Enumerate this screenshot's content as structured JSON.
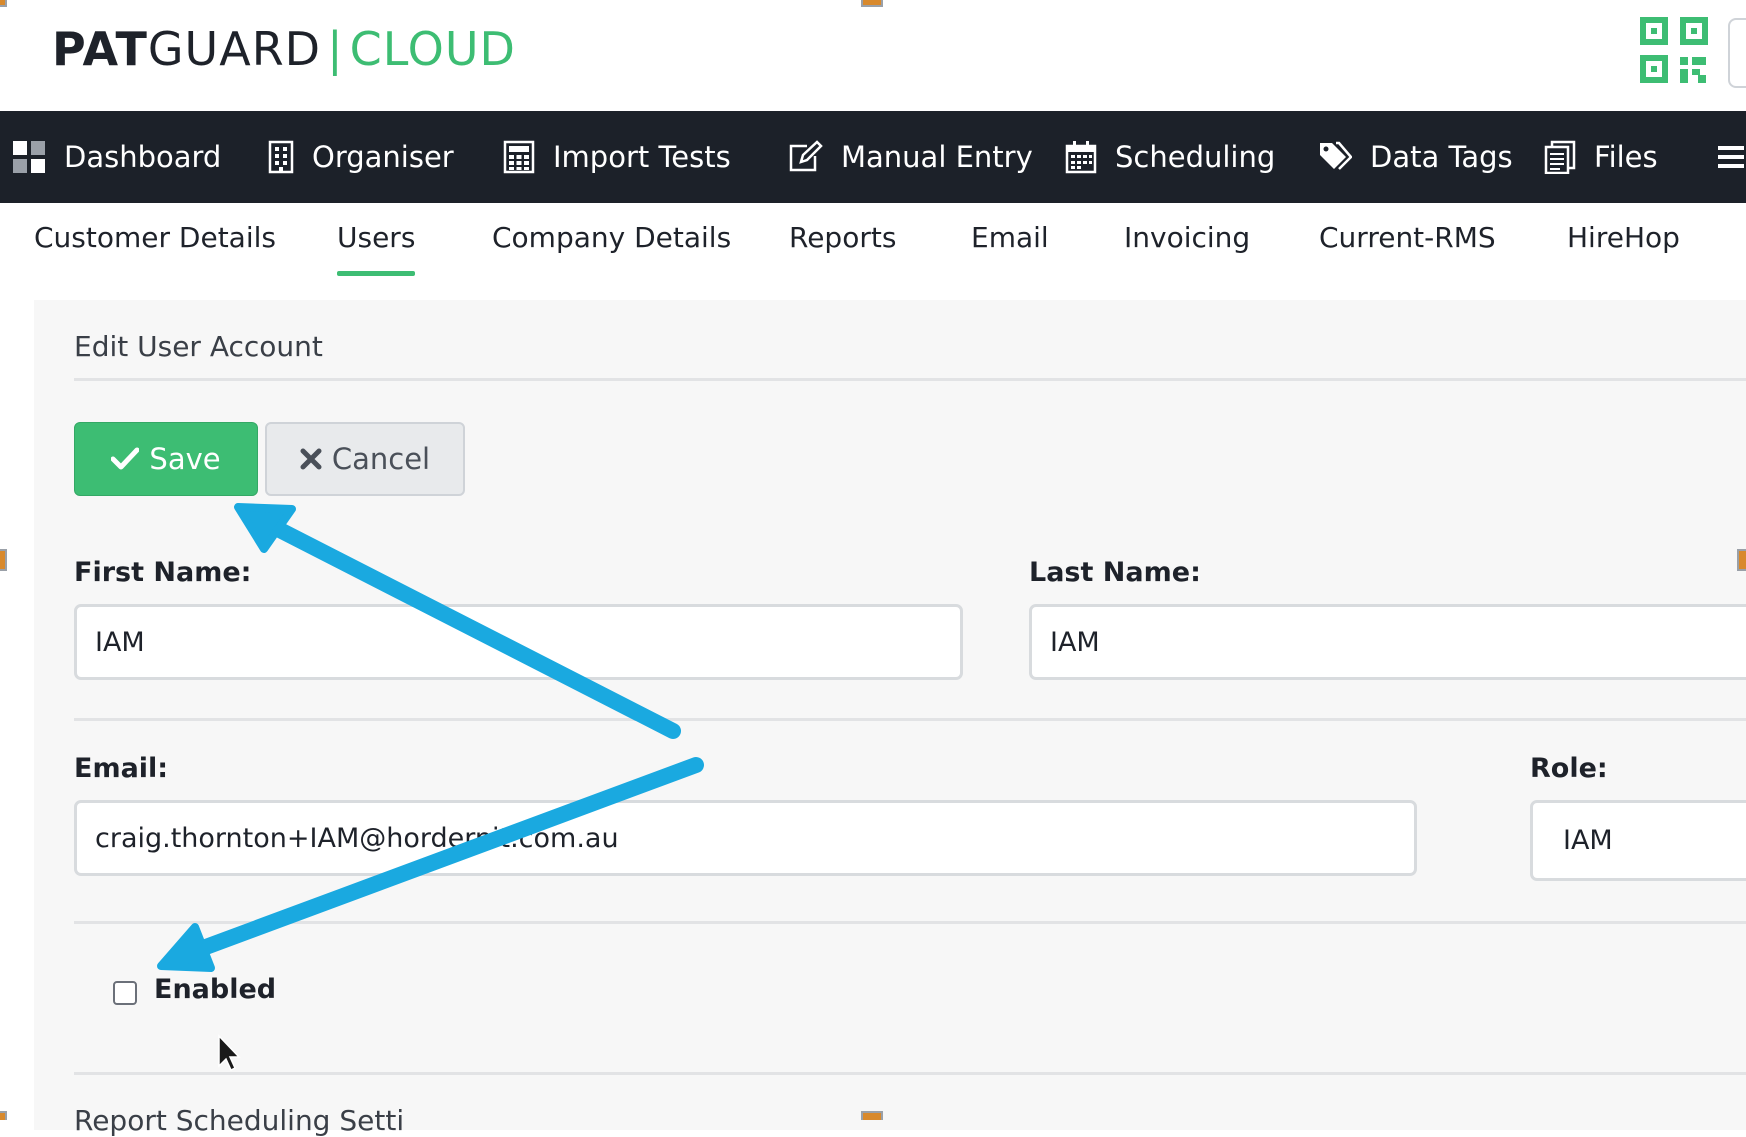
{
  "brand": {
    "part1": "PAT",
    "part2": "GUARD",
    "separator": "|",
    "part3": "CLOUD"
  },
  "nav": {
    "items": [
      {
        "label": "Dashboard",
        "icon": "dashboard-icon"
      },
      {
        "label": "Organiser",
        "icon": "building-icon"
      },
      {
        "label": "Import Tests",
        "icon": "calculator-icon"
      },
      {
        "label": "Manual Entry",
        "icon": "edit-icon"
      },
      {
        "label": "Scheduling",
        "icon": "calendar-icon"
      },
      {
        "label": "Data Tags",
        "icon": "tags-icon"
      },
      {
        "label": "Files",
        "icon": "files-icon"
      }
    ]
  },
  "subtabs": {
    "items": [
      "Customer Details",
      "Users",
      "Company Details",
      "Reports",
      "Email",
      "Invoicing",
      "Current-RMS",
      "HireHop"
    ],
    "active": "Users"
  },
  "form": {
    "title": "Edit User Account",
    "save_label": "Save",
    "cancel_label": "Cancel",
    "first_name_label": "First Name:",
    "first_name_value": "IAM",
    "last_name_label": "Last Name:",
    "last_name_value": "IAM",
    "email_label": "Email:",
    "email_value": "craig.thornton+IAM@hordernit.com.au",
    "role_label": "Role:",
    "role_value": "IAM",
    "enabled_label": "Enabled",
    "enabled_checked": false,
    "next_section": "Report Scheduling Setti"
  },
  "colors": {
    "accent": "#3dbd73",
    "nav_bg": "#1c2129",
    "annotation_arrow": "#1aa9e0"
  }
}
